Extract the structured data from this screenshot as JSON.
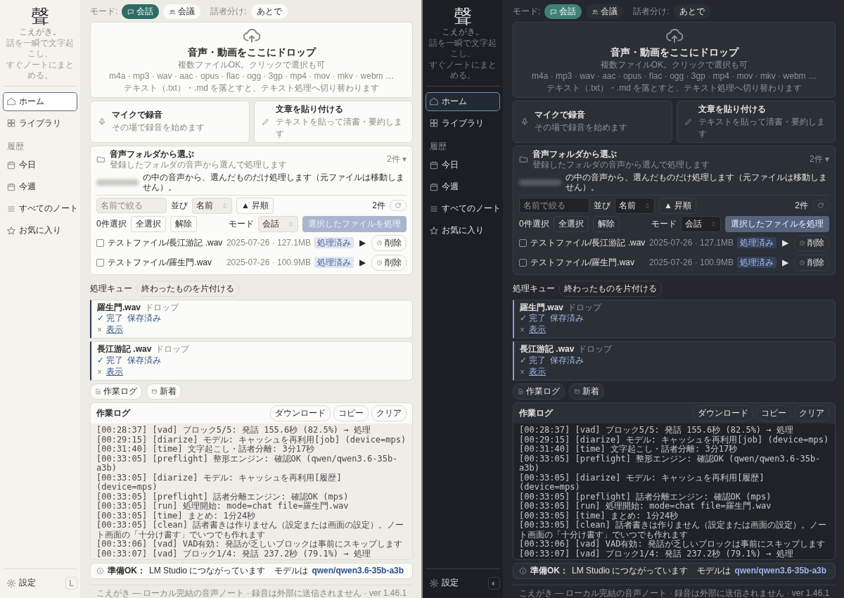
{
  "panels": [
    {
      "kind": "light",
      "brand": {
        "logo": "聲",
        "name": "こえがき。",
        "tagline": [
          "話を一瞬で文字起こし、",
          "すぐノートにまとめる。"
        ]
      },
      "nav": [
        {
          "label": "ホーム",
          "selected": true
        },
        {
          "label": "ライブラリ",
          "selected": false
        }
      ],
      "history": {
        "heading": "履歴",
        "items": [
          {
            "label": "今日",
            "selected": false
          },
          {
            "label": "今週",
            "selected": false
          },
          {
            "label": "すべてのノート",
            "selected": false
          },
          {
            "label": "お気に入り",
            "selected": false
          }
        ]
      },
      "settings": "設定",
      "theme_toggle": "L",
      "mode_bar": {
        "label": "モード:",
        "modes": [
          {
            "label": "会話",
            "selected": true
          },
          {
            "label": "会議",
            "selected": false
          }
        ],
        "diarize_label": "話者分け:",
        "diarize_value": "あとで"
      },
      "drop": {
        "title": "音声・動画をここにドロップ",
        "subtitle": "複数ファイルOK。クリックで選択も可",
        "formats": "m4a · mp3 · wav · aac · opus · flac · ogg · 3gp · mp4 · mov · mkv · webm …",
        "text_note": "テキスト（.txt）・.md を落とすと、テキスト処理へ切り替わります"
      },
      "actions": [
        {
          "title": "マイクで録音",
          "desc": "その場で録音を始めます"
        },
        {
          "title": "文章を貼り付ける",
          "desc": "テキストを貼って清書・要約します"
        }
      ],
      "folder": {
        "title": "音声フォルダから選ぶ",
        "desc": "登録したフォルダの音声から選んで処理します",
        "count": "2件 ▾",
        "path_suffix": "の中の音声から、選んだものだけ処理します（元ファイルは移動しません）。",
        "filter_placeholder": "名前で絞る",
        "sort_label": "並び",
        "sort_value": "名前",
        "order": "▲ 昇順",
        "total": "2件",
        "selected_count": "0件選択",
        "select_all": "全選択",
        "clear": "解除",
        "mode_label": "モード",
        "mode_value": "会話",
        "process": {
          "label": "選択したファイルを処理",
          "disabled": true
        },
        "files": [
          {
            "checked": false,
            "name": "テストファイル/長江游記 .wav",
            "meta": "2025-07-26 · 127.1MB",
            "status": "処理済み",
            "play": "▶",
            "delete": "削除"
          },
          {
            "checked": false,
            "name": "テストファイル/羅生門.wav",
            "meta": "2025-07-26 · 100.9MB",
            "status": "処理済み",
            "play": "▶",
            "delete": "削除"
          }
        ]
      },
      "queue": {
        "title": "処理キュー",
        "clear_button": "終わったものを片付ける",
        "items": [
          {
            "name": "羅生門.wav",
            "source": "ドロップ",
            "status": "✓ 完了",
            "saved": "保存済み",
            "toggle": "×",
            "show": "表示"
          },
          {
            "name": "長江游記 .wav",
            "source": "ドロップ",
            "status": "✓ 完了",
            "saved": "保存済み",
            "toggle": "×",
            "show": "表示"
          }
        ]
      },
      "toggles": [
        "作業ログ",
        "新着"
      ],
      "log": {
        "title": "作業ログ",
        "buttons": [
          "ダウンロード",
          "コピー",
          "クリア"
        ],
        "lines": [
          "[00:28:37] [vad] ブロック5/5: 発話 155.6秒 (82.5%) → 処理",
          "[00:29:15] [diarize] モデル: キャッシュを再利用[job] (device=mps)",
          "[00:31:40] [time] 文字起こし・話者分離: 3分17秒",
          "[00:33:05] [preflight] 整形エンジン: 確認OK (qwen/qwen3.6-35b-a3b)",
          "[00:33:05] [diarize] モデル: キャッシュを再利用[履歴] (device=mps)",
          "[00:33:05] [preflight] 話者分離エンジン: 確認OK (mps)",
          "[00:33:05] [run] 処理開始: mode=chat file=羅生門.wav",
          "[00:33:05] [time] まとめ: 1分24秒",
          "[00:33:05] [clean] 話者書きは作りません（設定または画面の設定）。ノート画面の「十分け書す」でいつでも作れます",
          "[00:33:06] [vad] VAD有効: 発話が乏しいブロックは事前にスキップします",
          "[00:33:07] [vad] ブロック1/4: 発話 237.2秒 (79.1%) → 処理"
        ]
      },
      "status": {
        "label": "準備OK：",
        "text": "LM Studio につながっています",
        "model_label": "モデルは",
        "model": "qwen/qwen3.6-35b-a3b"
      },
      "footer": "こえがき — ローカル完結の音声ノート · 録音は外部に送信されません · ver 1.46.1"
    },
    {
      "kind": "dark",
      "brand": {
        "logo": "聲",
        "name": "こえがき。",
        "tagline": [
          "話を一瞬で文字起こし、",
          "すぐノートにまとめる。"
        ]
      },
      "nav": [
        {
          "label": "ホーム",
          "selected": true
        },
        {
          "label": "ライブラリ",
          "selected": false
        }
      ],
      "history": {
        "heading": "履歴",
        "items": [
          {
            "label": "今日",
            "selected": false
          },
          {
            "label": "今週",
            "selected": false
          },
          {
            "label": "すべてのノート",
            "selected": false
          },
          {
            "label": "お気に入り",
            "selected": false
          }
        ]
      },
      "settings": "設定",
      "theme_toggle": "◐",
      "mode_bar": {
        "label": "モード:",
        "modes": [
          {
            "label": "会話",
            "selected": true
          },
          {
            "label": "会議",
            "selected": false
          }
        ],
        "diarize_label": "話者分け:",
        "diarize_value": "あとで"
      },
      "drop": {
        "title": "音声・動画をここにドロップ",
        "subtitle": "複数ファイルOK。クリックで選択も可",
        "formats": "m4a · mp3 · wav · aac · opus · flac · ogg · 3gp · mp4 · mov · mkv · webm …",
        "text_note": "テキスト（.txt）・.md を落とすと、テキスト処理へ切り替わります"
      },
      "actions": [
        {
          "title": "マイクで録音",
          "desc": "その場で録音を始めます"
        },
        {
          "title": "文章を貼り付ける",
          "desc": "テキストを貼って清書・要約します"
        }
      ],
      "folder": {
        "title": "音声フォルダから選ぶ",
        "desc": "登録したフォルダの音声から選んで処理します",
        "count": "2件 ▾",
        "path_suffix": "の中の音声から、選んだものだけ処理します（元ファイルは移動しません）。",
        "filter_placeholder": "名前で絞る",
        "sort_label": "並び",
        "sort_value": "名前",
        "order": "▲ 昇順",
        "total": "2件",
        "selected_count": "0件選択",
        "select_all": "全選択",
        "clear": "解除",
        "mode_label": "モード",
        "mode_value": "会話",
        "process": {
          "label": "選択したファイルを処理",
          "disabled": true
        },
        "files": [
          {
            "checked": false,
            "name": "テストファイル/長江游記 .wav",
            "meta": "2025-07-26 · 127.1MB",
            "status": "処理済み",
            "play": "▶",
            "delete": "削除"
          },
          {
            "checked": false,
            "name": "テストファイル/羅生門.wav",
            "meta": "2025-07-26 · 100.9MB",
            "status": "処理済み",
            "play": "▶",
            "delete": "削除"
          }
        ]
      },
      "queue": {
        "title": "処理キュー",
        "clear_button": "終わったものを片付ける",
        "items": [
          {
            "name": "羅生門.wav",
            "source": "ドロップ",
            "status": "✓ 完了",
            "saved": "保存済み",
            "toggle": "×",
            "show": "表示"
          },
          {
            "name": "長江游記 .wav",
            "source": "ドロップ",
            "status": "✓ 完了",
            "saved": "保存済み",
            "toggle": "×",
            "show": "表示"
          }
        ]
      },
      "toggles": [
        "作業ログ",
        "新着"
      ],
      "log": {
        "title": "作業ログ",
        "buttons": [
          "ダウンロード",
          "コピー",
          "クリア"
        ],
        "lines": [
          "[00:28:37] [vad] ブロック5/5: 発話 155.6秒 (82.5%) → 処理",
          "[00:29:15] [diarize] モデル: キャッシュを再利用[job] (device=mps)",
          "[00:31:40] [time] 文字起こし・話者分離: 3分17秒",
          "[00:33:05] [preflight] 整形エンジン: 確認OK (qwen/qwen3.6-35b-a3b)",
          "[00:33:05] [diarize] モデル: キャッシュを再利用[履歴] (device=mps)",
          "[00:33:05] [preflight] 話者分離エンジン: 確認OK (mps)",
          "[00:33:05] [run] 処理開始: mode=chat file=羅生門.wav",
          "[00:33:05] [time] まとめ: 1分24秒",
          "[00:33:05] [clean] 話者書きは作りません（設定または画面の設定）。ノート画面の「十分け書す」でいつでも作れます",
          "[00:33:06] [vad] VAD有効: 発話が乏しいブロックは事前にスキップします",
          "[00:33:07] [vad] ブロック1/4: 発話 237.2秒 (79.1%) → 処理"
        ]
      },
      "status": {
        "label": "準備OK：",
        "text": "LM Studio につながっています",
        "model_label": "モデルは",
        "model": "qwen/qwen3.6-35b-a3b"
      },
      "footer": "こえがき — ローカル完結の音声ノート · 録音は外部に送信されません · ver 1.46.1"
    }
  ]
}
